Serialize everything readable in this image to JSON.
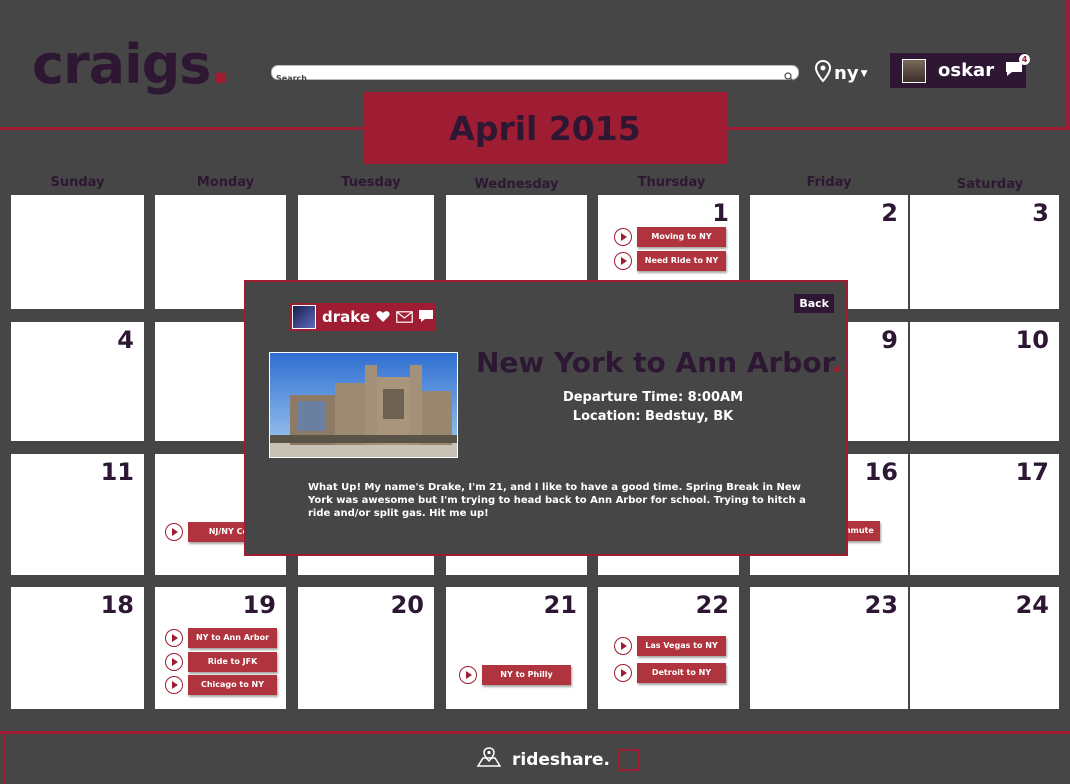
{
  "header": {
    "logo": "craigs",
    "logo_dot": ".",
    "search_placeholder": "Search",
    "location": "ny",
    "user": {
      "name": "oskar",
      "notifications": "4"
    }
  },
  "calendar": {
    "month": "April 2015",
    "days": [
      "Sunday",
      "Monday",
      "Tuesday",
      "Wednesday",
      "Thursday",
      "Friday",
      "Saturday"
    ],
    "dates": [
      "1",
      "2",
      "3",
      "4",
      "9",
      "10",
      "11",
      "16",
      "17",
      "18",
      "19",
      "20",
      "21",
      "22",
      "23",
      "24"
    ],
    "events": {
      "d1": [
        "Moving to NY",
        "Need Ride to NY"
      ],
      "d13": "NJ/NY Com",
      "d16": "mmute",
      "d19": [
        "NY to Ann Arbor",
        "Ride to JFK",
        "Chicago to NY"
      ],
      "d21": "NY to Philly",
      "d22": [
        "Las Vegas to NY",
        "Detroit to NY"
      ]
    }
  },
  "modal": {
    "poster_name": "drake",
    "back_label": "Back",
    "title": "New York to Ann Arbor",
    "title_dot": ".",
    "departure": "Departure Time: 8:00AM",
    "location": "Location: Bedstuy, BK",
    "description": "What Up! My name's Drake, I'm 21, and I like to have a good time. Spring Break in New York was awesome but I'm trying to head back to Ann Arbor for school. Trying to hitch a ride and/or split gas. Hit me up!"
  },
  "footer": {
    "label": "rideshare."
  },
  "colors": {
    "background": "#464646",
    "accent": "#9e1d33",
    "dark": "#2d1733"
  }
}
